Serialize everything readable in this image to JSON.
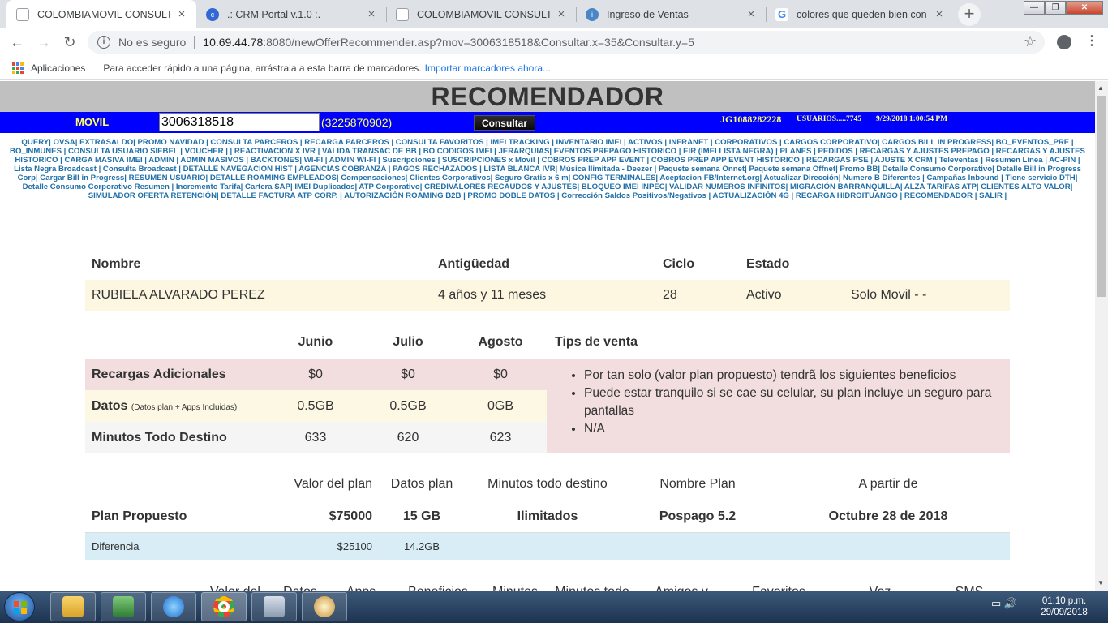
{
  "browser": {
    "tabs": [
      {
        "title": "COLOMBIAMOVIL CONSULTA IN",
        "active": true,
        "favicon": "page-icon",
        "color": "#8ab4f8"
      },
      {
        "title": ".: CRM Portal v.1.0 :.",
        "active": false,
        "favicon": "crm-icon",
        "color": "#3367d6"
      },
      {
        "title": "COLOMBIAMOVIL CONSULTA IN",
        "active": false,
        "favicon": "page-icon",
        "color": "#8ab4f8"
      },
      {
        "title": "Ingreso de Ventas",
        "active": false,
        "favicon": "sales-icon",
        "color": "#4a86c5"
      },
      {
        "title": "colores que queden bien con gr",
        "active": false,
        "favicon": "google-icon",
        "color": "#4285f4"
      }
    ],
    "address": {
      "security": "No es seguro",
      "host": "10.69.44.78",
      "path": ":8080/newOfferRecommender.asp?mov=3006318518&Consultar.x=35&Consultar.y=5"
    },
    "bookmarks": {
      "apps": "Aplicaciones",
      "hint": "Para acceder rápido a una página, arrástrala a esta barra de marcadores.",
      "import": "Importar marcadores ahora..."
    }
  },
  "header": {
    "title": "RECOMENDADOR",
    "movil_label": "MOVIL",
    "phone_value": "3006318518",
    "alt_phone": "(3225870902)",
    "consult_button": "Consultar",
    "user_code": "JG1088282228",
    "users": "USUARIOS.....7745",
    "datetime": "9/29/2018 1:00:54 PM"
  },
  "menu_text": "QUERY| OVSA| EXTRASALDO| PROMO NAVIDAD | CONSULTA PARCEROS | RECARGA PARCEROS | CONSULTA FAVORITOS | IMEI TRACKING | INVENTARIO IMEI | ACTIVOS | INFRANET | CORPORATIVOS | CARGOS CORPORATIVO| CARGOS BILL IN PROGRESS| BO_EVENTOS_PRE | BO_INMUNES | CONSULTA USUARIO SIEBEL | VOUCHER | | REACTIVACION X IVR | VALIDA TRANSAC DE BB | BO CODIGOS IMEI | JERARQUIAS| EVENTOS PREPAGO HISTORICO | EIR (IMEI LISTA NEGRA) | PLANES | PEDIDOS | RECARGAS Y AJUSTES PREPAGO | RECARGAS Y AJUSTES HISTORICO | CARGA MASIVA IMEI | ADMIN | ADMIN MASIVOS | BACKTONES| WI-FI | ADMIN WI-FI | Suscripciones | SUSCRIPCIONES x Movil | COBROS PREP APP EVENT | COBROS PREP APP EVENT HISTORICO | RECARGAS PSE | AJUSTE X CRM | Televentas | Resumen Linea | AC-PIN | Lista Negra Broadcast | Consulta Broadcast | DETALLE NAVEGACION HIST | AGENCIAS COBRANZA | PAGOS RECHAZADOS | LISTA BLANCA IVR| Música Ilimitada - Deezer | Paquete semana Onnet| Paquete semana Offnet| Promo BB| Detalle Consumo Corporativo| Detalle Bill in Progress Corp| Cargar Bill in Progress| RESUMEN USUARIO| DETALLE ROAMING EMPLEADOS| Compensaciones| Clientes Corporativos| Seguro Gratis x 6 m| CONFIG TERMINALES| Aceptacion FB/Internet.org| Actualizar Dirección| Numero B Diferentes | Campañas Inbound | Tiene servicio DTH| Detalle Consumo Corporativo Resumen | Incremento Tarifa| Cartera SAP| IMEI Duplicados| ATP Corporativo| CREDIVALORES RECAUDOS Y AJUSTES| BLOQUEO IMEI INPEC| VALIDAR NUMEROS INFINITOS| MIGRACIÓN BARRANQUILLA| ALZA TARIFAS ATP| CLIENTES ALTO VALOR| SIMULADOR OFERTA RETENCIÓN| DETALLE FACTURA ATP CORP. | AUTORIZACIÓN ROAMING B2B | PROMO DOBLE DATOS | Corrección Saldos Positivos/Negativos | ACTUALIZACIÓN 4G | RECARGA HIDROITUANGO | RECOMENDADOR | SALIR |",
  "customer": {
    "headers": [
      "Nombre",
      "Antigüedad",
      "Ciclo",
      "Estado",
      ""
    ],
    "values": [
      "RUBIELA ALVARADO PEREZ",
      "4 años y 11 meses",
      "28",
      "Activo",
      "Solo Movil - -"
    ]
  },
  "usage": {
    "months": [
      "Junio",
      "Julio",
      "Agosto"
    ],
    "tips_header": "Tips de venta",
    "rows": [
      {
        "label": "Recargas Adicionales",
        "note": "",
        "values": [
          "$0",
          "$0",
          "$0"
        ]
      },
      {
        "label": "Datos",
        "note": "(Datos plan + Apps Incluidas)",
        "values": [
          "0.5GB",
          "0.5GB",
          "0GB"
        ]
      },
      {
        "label": "Minutos Todo Destino",
        "note": "",
        "values": [
          "633",
          "620",
          "623"
        ]
      }
    ],
    "tips": [
      "Por tan solo (valor plan propuesto) tendrã los siguientes beneficios",
      "Puede estar tranquilo si se cae su celular, su plan incluye un seguro para pantallas",
      "N/A"
    ]
  },
  "plan": {
    "headers": [
      "",
      "Valor del plan",
      "Datos plan",
      "Minutos todo destino",
      "Nombre Plan",
      "A partir de"
    ],
    "proposed": [
      "Plan Propuesto",
      "$75000",
      "15 GB",
      "Ilimitados",
      "Pospago 5.2",
      "Octubre 28 de 2018"
    ],
    "difference": [
      "Diferencia",
      "$25100",
      "14.2GB",
      "",
      "",
      ""
    ]
  },
  "more_headers": [
    "Valor del",
    "Datos",
    "Apps",
    "Beneficios",
    "Minutos",
    "Minutos todo",
    "Amigos y",
    "Favoritos",
    "Voz",
    "SMS"
  ],
  "taskbar": {
    "time": "01:10 p.m.",
    "date": "29/09/2018"
  }
}
